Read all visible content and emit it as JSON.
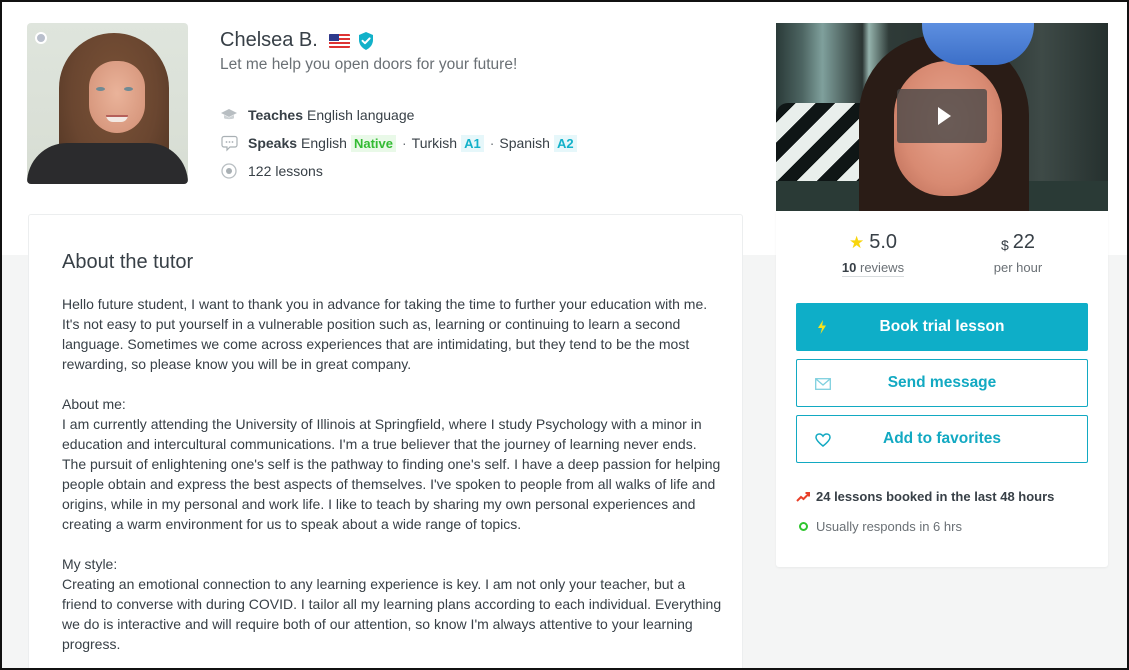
{
  "tutor": {
    "name": "Chelsea B.",
    "country_flag": "us-flag",
    "verified": true,
    "tagline": "Let me help you open doors for your future!",
    "status": "offline",
    "facts": {
      "teaches_label": "Teaches",
      "teaches_value": "English language",
      "speaks_label": "Speaks",
      "languages": [
        {
          "name": "English",
          "level": "Native"
        },
        {
          "name": "Turkish",
          "level": "A1"
        },
        {
          "name": "Spanish",
          "level": "A2"
        }
      ],
      "separator": "·",
      "lessons_count": "122",
      "lessons_label": "lessons"
    }
  },
  "about": {
    "title": "About the tutor",
    "intro": "Hello future student, I want to thank you in advance for taking the time to further your education with me. It's not easy to put yourself in a vulnerable position such as, learning or continuing to learn a second language. Sometimes we come across experiences that are intimidating, but they tend to be the most rewarding, so please know you will be in great company.",
    "about_me_heading": "About me:",
    "about_me": "I am currently attending the University of Illinois at Springfield, where I study Psychology with a minor in education and intercultural communications. I'm a true believer that the journey of learning never ends. The pursuit of enlightening one's self is the pathway to finding one's self. I have a deep passion for helping people obtain and express the best aspects of themselves. I've spoken to people from all walks of life and origins, while in my personal and work life. I like to teach by sharing my own personal experiences and creating a warm environment for us to speak about a wide range of topics.",
    "my_style_heading": "My style:",
    "my_style": "Creating an emotional connection to any learning experience is key. I am not only your teacher, but a friend to converse with during COVID. I tailor all my learning plans according to each individual. Everything we do is interactive and will require both of our attention, so know I'm always attentive to your learning progress."
  },
  "sidebar": {
    "video": {
      "play_icon": "play-icon"
    },
    "rating": {
      "value": "5.0",
      "reviews_count": "10",
      "reviews_label": "reviews"
    },
    "price": {
      "currency": "$",
      "amount": "22",
      "unit": "per hour"
    },
    "buttons": {
      "book_trial": "Book trial lesson",
      "send_message": "Send message",
      "add_favorites": "Add to favorites"
    },
    "booked_info": "24 lessons booked in the last 48 hours",
    "response_info": "Usually responds in 6 hrs"
  },
  "colors": {
    "accent": "#0eaec8",
    "native_badge": "#33bb33",
    "level_badge": "#12b1c9",
    "star": "#f8d50d",
    "trend": "#e8402a",
    "online_ring": "#2ec52e"
  }
}
